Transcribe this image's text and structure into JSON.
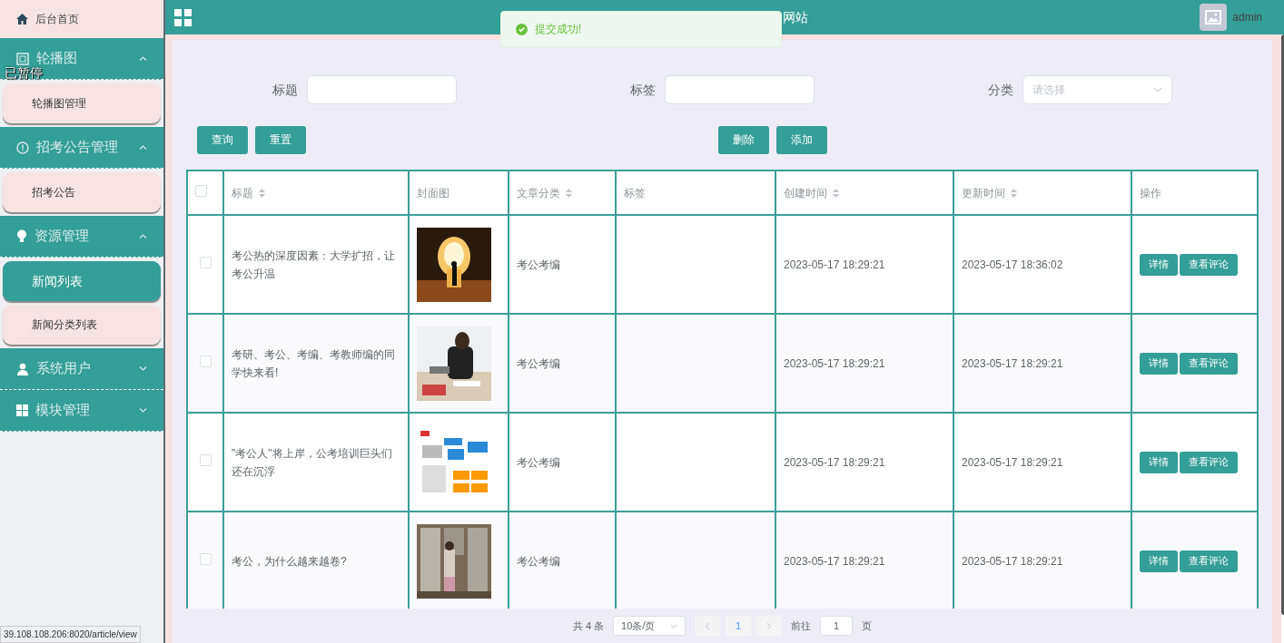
{
  "header": {
    "title": "网站",
    "user": "admin"
  },
  "toast": {
    "message": "提交成功!"
  },
  "overlay": {
    "label": "已暂停"
  },
  "sidebar": {
    "items": [
      {
        "kind": "link",
        "label": "后台首页"
      },
      {
        "kind": "group",
        "label": "轮播图",
        "expanded": true,
        "children": [
          {
            "label": "轮播图管理",
            "selected": false
          }
        ]
      },
      {
        "kind": "group",
        "label": "招考公告管理",
        "expanded": true,
        "children": [
          {
            "label": "招考公告",
            "selected": false
          }
        ]
      },
      {
        "kind": "group",
        "label": "资源管理",
        "expanded": true,
        "children": [
          {
            "label": "新闻列表",
            "selected": true
          },
          {
            "label": "新闻分类列表",
            "selected": false
          }
        ]
      },
      {
        "kind": "group",
        "label": "系统用户",
        "expanded": false
      },
      {
        "kind": "group",
        "label": "模块管理",
        "expanded": false
      }
    ]
  },
  "filters": [
    {
      "kind": "text",
      "label": "标题"
    },
    {
      "kind": "text",
      "label": "标签"
    },
    {
      "kind": "select",
      "label": "分类",
      "placeholder": "请选择"
    }
  ],
  "buttons_left": [
    "查询",
    "重置"
  ],
  "buttons_right": [
    "删除",
    "添加"
  ],
  "table": {
    "select_all_checked": false,
    "columns": [
      {
        "label": "标题",
        "sortable": true
      },
      {
        "label": "封面图",
        "sortable": false
      },
      {
        "label": "文章分类",
        "sortable": true
      },
      {
        "label": "标签",
        "sortable": false
      },
      {
        "label": "创建时间",
        "sortable": true
      },
      {
        "label": "更新时间",
        "sortable": true
      },
      {
        "label": "操作",
        "sortable": false
      }
    ],
    "rows": [
      {
        "checked": false,
        "title": "考公热的深度因素：大学扩招，让考公升温",
        "cover": {
          "kind": "picture"
        },
        "category": "考公考编",
        "created": "2023-05-17 18:29:21",
        "updated": "2023-05-17 18:36:02",
        "actions": [
          "详情",
          "查看评论"
        ]
      },
      {
        "checked": false,
        "title": "考研、考公、考编、考教师编的同学快来看!",
        "cover": {
          "kind": "picture"
        },
        "category": "考公考编",
        "created": "2023-05-17 18:29:21",
        "updated": "2023-05-17 18:29:21",
        "actions": [
          "详情",
          "查看评论"
        ]
      },
      {
        "checked": false,
        "title": "\"考公人\"将上岸，公考培训巨头们还在沉浮",
        "cover": {
          "kind": "picture"
        },
        "category": "考公考编",
        "created": "2023-05-17 18:29:21",
        "updated": "2023-05-17 18:29:21",
        "actions": [
          "详情",
          "查看评论"
        ]
      },
      {
        "checked": false,
        "title": "考公，为什么越来越卷?",
        "cover": {
          "kind": "picture"
        },
        "category": "考公考编",
        "created": "2023-05-17 18:29:21",
        "updated": "2023-05-17 18:29:21",
        "actions": [
          "详情",
          "查看评论"
        ]
      }
    ]
  },
  "pagination": {
    "total": "共 4 条",
    "page_size": "10条/页",
    "pages": [
      {
        "label": "1",
        "selected": true
      }
    ],
    "goto_label": "前往",
    "goto_value": "1",
    "goto_suffix": "页"
  },
  "status_bar": {
    "url": "39.108.108.206:8020/article/view"
  }
}
